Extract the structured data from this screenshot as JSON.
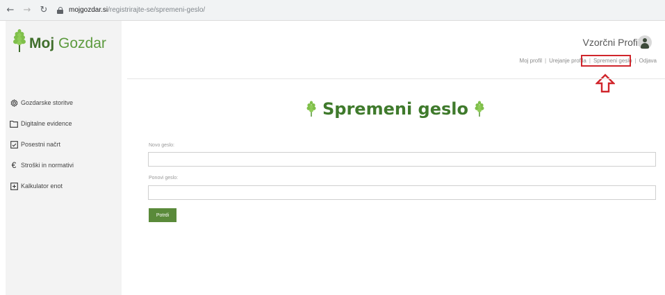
{
  "browser": {
    "url_host": "mojgozdar.si",
    "url_path": "/registrirajte-se/spremeni-geslo/"
  },
  "brand": {
    "name_bold": "Moj",
    "name_regular": "Gozdar",
    "accent_color": "#3f7a2c"
  },
  "sidebar": {
    "items": [
      {
        "label": "Gozdarske storitve",
        "icon": "gear-icon"
      },
      {
        "label": "Digitalne evidence",
        "icon": "folder-icon"
      },
      {
        "label": "Posestni načrt",
        "icon": "document-icon"
      },
      {
        "label": "Stroški in normativi",
        "icon": "euro-icon"
      },
      {
        "label": "Kalkulator enot",
        "icon": "calculator-icon"
      }
    ]
  },
  "header": {
    "profile_name": "Vzorčni Profil",
    "links": [
      "Moj profil",
      "Urejanje profila",
      "Spremeni geslo",
      "Odjava"
    ],
    "highlight_color": "#d0252b"
  },
  "main": {
    "title": "Spremeni geslo",
    "new_password_label": "Novo geslo:",
    "repeat_password_label": "Ponovi geslo:",
    "new_password_value": "",
    "repeat_password_value": "",
    "submit_label": "Potrdi",
    "button_color": "#5a8a3a"
  }
}
